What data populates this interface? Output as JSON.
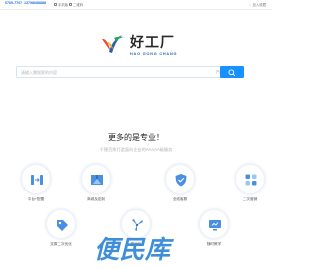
{
  "topbar": {
    "phones": [
      "0769-7707",
      "13798688888"
    ],
    "items": [
      "手机版",
      "二维码"
    ],
    "favorite": "加入收藏"
  },
  "brand": {
    "name_cn": "好工厂",
    "name_en": "HAO GONG CHANG"
  },
  "search": {
    "placeholder": "请输入需搜索的内容",
    "image_search_label": "产品"
  },
  "section": {
    "title": "更多的是专业！",
    "subtitle": "千锤百炼打造面向企业的AAAAA级服务"
  },
  "services": [
    {
      "label": "平台+配置",
      "icon": "settings-icon"
    },
    {
      "label": "商城及定制",
      "icon": "bookmark-icon"
    },
    {
      "label": "全线客服",
      "icon": "shield-icon"
    },
    {
      "label": "二次营销",
      "icon": "grid-icon"
    },
    {
      "label": "支撑二次优化",
      "icon": "tag-icon"
    },
    {
      "label": "移动化",
      "icon": "fan-icon"
    },
    {
      "label": "随时教学",
      "icon": "monitor-icon"
    }
  ],
  "watermark": "便民库",
  "colors": {
    "accent": "#1890ff",
    "brand_blue": "#2a5fb8",
    "icon_blue": "#4a90e2"
  }
}
